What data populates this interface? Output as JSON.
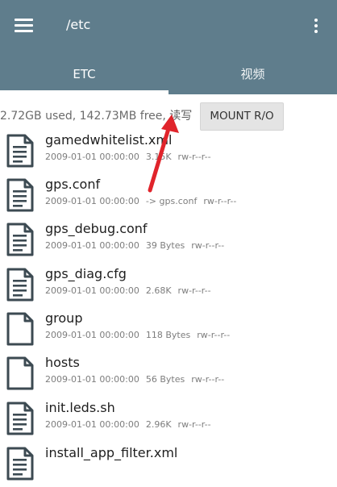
{
  "header": {
    "path": "/etc",
    "menu_icon": "hamburger-menu-icon",
    "more_icon": "more-vert-icon"
  },
  "tabs": [
    {
      "label": "ETC",
      "active": true
    },
    {
      "label": "视频",
      "active": false
    }
  ],
  "storage": {
    "usage": "2.72GB used, 142.73MB free,",
    "mode": "读写",
    "mount_button": "MOUNT R/O"
  },
  "files": [
    {
      "name": "gamedwhitelist.xml",
      "date": "2009-01-01 00:00:00",
      "size": "3.15K",
      "perm": "rw-r--r--",
      "icon": "text-file-icon"
    },
    {
      "name": "gps.conf",
      "date": "2009-01-01 00:00:00",
      "size": "-> gps.conf",
      "perm": "rw-r--r--",
      "icon": "text-file-icon"
    },
    {
      "name": "gps_debug.conf",
      "date": "2009-01-01 00:00:00",
      "size": "39 Bytes",
      "perm": "rw-r--r--",
      "icon": "text-file-icon"
    },
    {
      "name": "gps_diag.cfg",
      "date": "2009-01-01 00:00:00",
      "size": "2.68K",
      "perm": "rw-r--r--",
      "icon": "text-file-icon"
    },
    {
      "name": "group",
      "date": "2009-01-01 00:00:00",
      "size": "118 Bytes",
      "perm": "rw-r--r--",
      "icon": "blank-file-icon"
    },
    {
      "name": "hosts",
      "date": "2009-01-01 00:00:00",
      "size": "56 Bytes",
      "perm": "rw-r--r--",
      "icon": "blank-file-icon"
    },
    {
      "name": "init.leds.sh",
      "date": "2009-01-01 00:00:00",
      "size": "2.96K",
      "perm": "rw-r--r--",
      "icon": "text-file-icon"
    },
    {
      "name": "install_app_filter.xml",
      "date": "",
      "size": "",
      "perm": "",
      "icon": "text-file-icon"
    }
  ],
  "colors": {
    "appbar": "#5f7d8c",
    "annotation_arrow": "#e0242b"
  }
}
